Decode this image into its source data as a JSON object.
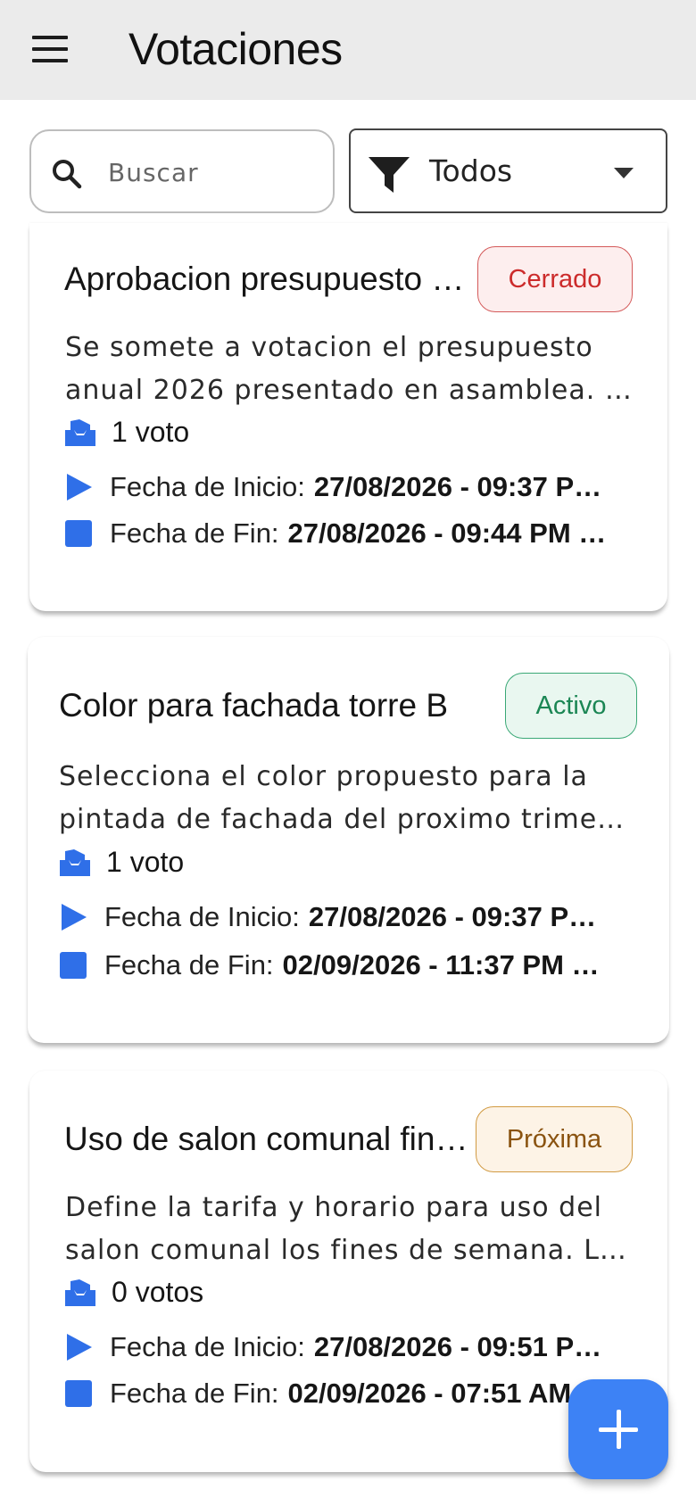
{
  "appbar": {
    "title": "Votaciones"
  },
  "search": {
    "placeholder": "Buscar"
  },
  "filter": {
    "selected": "Todos"
  },
  "labels": {
    "start": "Fecha de Inicio:",
    "end": "Fecha de Fin:"
  },
  "colors": {
    "accent": "#3d82f5",
    "icon_blue": "#2f6fe8"
  },
  "cards": [
    {
      "title": "Aprobacion presupuesto …",
      "status": "Cerrado",
      "desc_line1": "Se somete a votacion el presupuesto",
      "desc_line2": "anual 2026 presentado en asamblea. …",
      "votes": "1 voto",
      "start": "27/08/2026 - 09:37 P…",
      "end": "27/08/2026 - 09:44 PM …"
    },
    {
      "title": "Color para fachada torre B",
      "status": "Activo",
      "desc_line1": "Selecciona el color propuesto para la",
      "desc_line2": "pintada de fachada del proximo trime…",
      "votes": "1 voto",
      "start": "27/08/2026 - 09:37 P…",
      "end": "02/09/2026 - 11:37 PM …"
    },
    {
      "title": "Uso de salon comunal fin…",
      "status": "Próxima",
      "desc_line1": "Define la tarifa y horario para uso del",
      "desc_line2": "salon comunal los fines de semana. La…",
      "votes": "0 votos",
      "start": "27/08/2026 - 09:51 P…",
      "end": "02/09/2026 - 07:51 AM"
    }
  ]
}
